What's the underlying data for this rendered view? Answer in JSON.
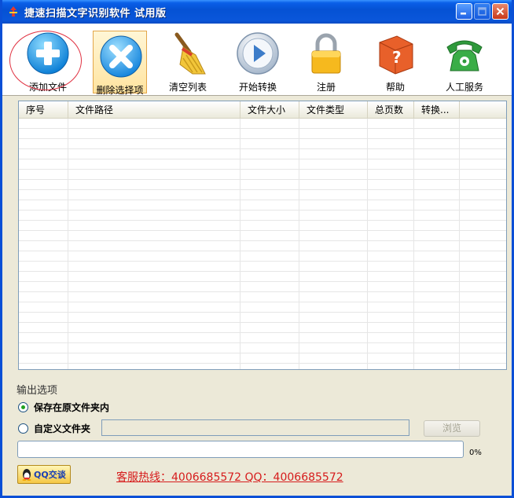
{
  "window": {
    "title": "捷速扫描文字识别软件  试用版"
  },
  "toolbar": {
    "add_file": "添加文件",
    "delete_selected": "删除选择项",
    "clear_list": "清空列表",
    "start_convert": "开始转换",
    "register": "注册",
    "help": "帮助",
    "human_service": "人工服务"
  },
  "list": {
    "columns": [
      "序号",
      "文件路径",
      "文件大小",
      "文件类型",
      "总页数",
      "转换..."
    ]
  },
  "output": {
    "title": "输出选项",
    "save_in_source": "保存在原文件夹内",
    "custom_folder": "自定义文件夹",
    "custom_path_value": "",
    "browse": "浏览",
    "selected_option": "save_in_source"
  },
  "progress": {
    "value_percent": 0,
    "label": "0%"
  },
  "footer": {
    "qq_button": "QQ交谈",
    "hotline": "客服热线：4006685572 QQ：4006685572"
  },
  "colors": {
    "titlebar": "#0552d4",
    "hotline": "#d61c1c",
    "annotation_circle": "#e03040"
  }
}
